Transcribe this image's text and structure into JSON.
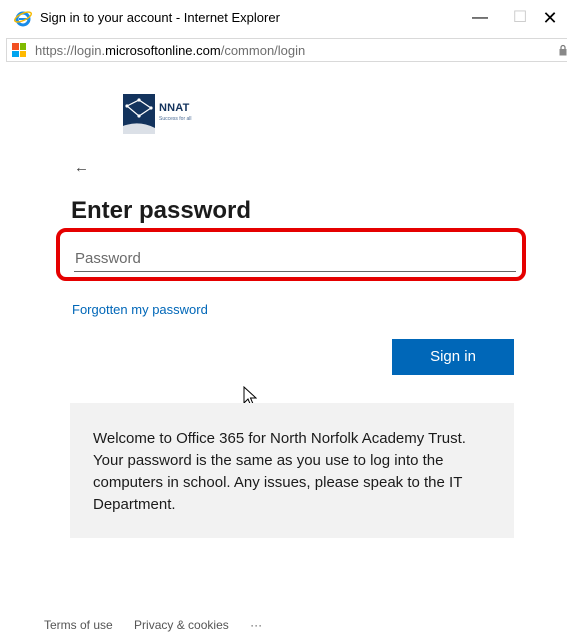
{
  "window": {
    "title": "Sign in to your account - Internet Explorer",
    "minimize_label": "—",
    "maximize_label": "☐",
    "close_label": "✕"
  },
  "addressbar": {
    "url_prefix": "https://login.",
    "url_domain": "microsoftonline.com",
    "url_path": "/common/login"
  },
  "logo": {
    "name": "NNAT",
    "tagline": "Success for all"
  },
  "page": {
    "back_label": "←",
    "heading": "Enter password",
    "password_placeholder": "Password",
    "forgot_link": "Forgotten my password",
    "signin_label": "Sign in",
    "notice": "Welcome to Office 365 for North Norfolk Academy Trust. Your password is the same as you use to log into the computers in school. Any issues, please speak to the IT Department."
  },
  "footer": {
    "terms": "Terms of use",
    "privacy": "Privacy & cookies",
    "more": "···"
  },
  "colors": {
    "accent": "#0067b8",
    "highlight": "#e50000",
    "brand_navy": "#13335d"
  },
  "icons": {
    "browser": "internet-explorer-icon",
    "site": "microsoft-logo-icon",
    "lock": "lock-icon",
    "cursor": "mouse-pointer-icon"
  }
}
